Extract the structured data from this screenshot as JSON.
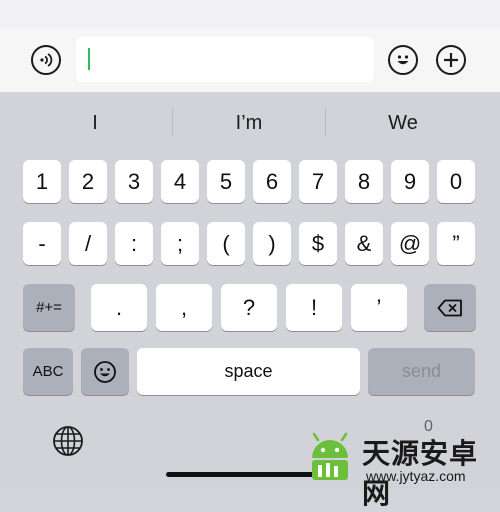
{
  "input_bar": {
    "voice_icon": "voice-wave-icon",
    "emoji_icon": "smiley-icon",
    "add_icon": "plus-icon",
    "text_value": ""
  },
  "suggestions": [
    "I",
    "I’m",
    "We"
  ],
  "rows": {
    "digits": [
      "1",
      "2",
      "3",
      "4",
      "5",
      "6",
      "7",
      "8",
      "9",
      "0"
    ],
    "symbols": [
      "-",
      "/",
      ":",
      ";",
      "(",
      ")",
      "$",
      "&",
      "@",
      "”"
    ],
    "punct": [
      ".",
      ",",
      "?",
      "!",
      "’"
    ]
  },
  "keys": {
    "more_symbols": "#+=",
    "abc": "ABC",
    "space": "space",
    "send": "send",
    "delete_icon": "backspace-icon",
    "emoji_icon": "smiley-icon",
    "globe_icon": "globe-icon"
  },
  "watermark": {
    "title": "天源安卓网",
    "url": "www.jytyaz.com"
  },
  "ghost_text": "0",
  "colors": {
    "caret": "#2dbd5a",
    "keyboard_bg": "#d1d3d9",
    "key_bg": "#ffffff",
    "dark_key_bg": "#abb0ba"
  }
}
